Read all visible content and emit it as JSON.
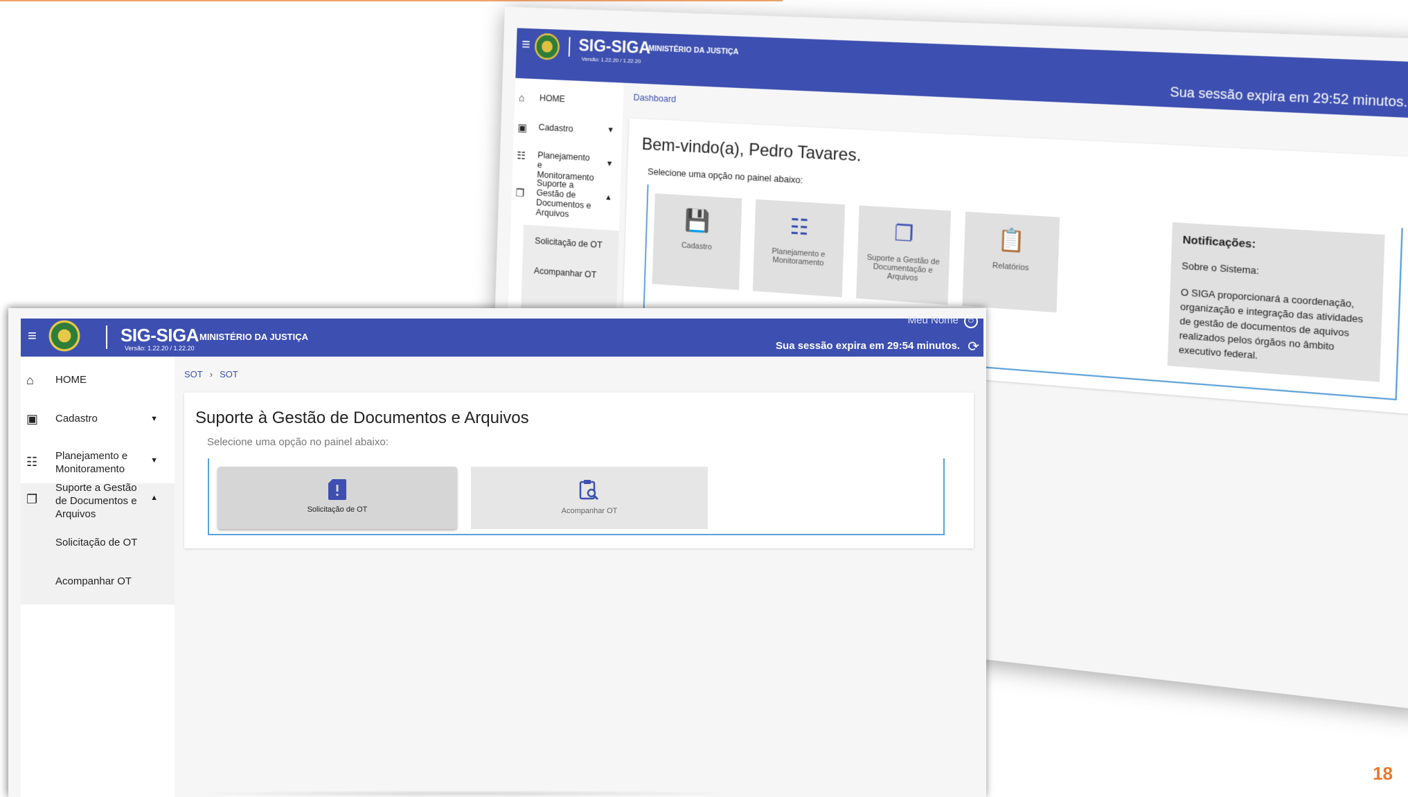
{
  "page_number": "18",
  "colors": {
    "header": "#3d4fb0",
    "accent_border": "#5aa0d8",
    "page_number": "#e8782a"
  },
  "back_window": {
    "header": {
      "menu_icon": "hamburger-icon",
      "app_name": "SIG-SIGA",
      "ministry": "MINISTÉRIO DA JUSTIÇA",
      "version": "Versão: 1.22.20 / 1.22.20",
      "session": "Sua sessão expira em 29:52 minutos.",
      "refresh_icon": "refresh-icon"
    },
    "sidebar": [
      {
        "icon": "home-icon",
        "label": "HOME"
      },
      {
        "icon": "badge-icon",
        "label": "Cadastro"
      },
      {
        "icon": "planning-icon",
        "label": "Planejamento e Monitoramento"
      },
      {
        "icon": "documents-icon",
        "label": "Suporte a Gestão de Documentos e Arquivos"
      }
    ],
    "sub_items": [
      "Solicitação de OT",
      "Acompanhar OT"
    ],
    "breadcrumb": "Dashboard",
    "welcome": "Bem-vindo(a), Pedro Tavares.",
    "choose": "Selecione uma opção no painel abaixo:",
    "tiles": [
      {
        "icon": "save-icon",
        "label": "Cadastro"
      },
      {
        "icon": "planning-icon",
        "label": "Planejamento e Monitoramento"
      },
      {
        "icon": "documents-icon",
        "label": "Suporte a Gestão de Documentação e Arquivos"
      },
      {
        "icon": "clipboard-icon",
        "label": "Relatórios"
      }
    ],
    "notifications": {
      "title": "Notificações:",
      "subtitle": "Sobre o Sistema:",
      "body": "O SIGA proporcionará a coordenação, organização e integração das atividades de gestão de documentos de aquivos realizados pelos órgãos no âmbito executivo federal."
    }
  },
  "front_window": {
    "header": {
      "menu_icon": "hamburger-icon",
      "app_name": "SIG-SIGA",
      "ministry": "MINISTÉRIO DA JUSTIÇA",
      "version": "Versão: 1.22.20 / 1.22.20",
      "user": "Meu Nome",
      "session": "Sua sessão expira em 29:54 minutos.",
      "refresh_icon": "refresh-icon"
    },
    "sidebar": {
      "home": "HOME",
      "cadastro": "Cadastro",
      "planejamento_1": "Planejamento e",
      "planejamento_2": "Monitoramento",
      "suporte_1": "Suporte a Gestão",
      "suporte_2": "de Documentos e",
      "suporte_3": "Arquivos",
      "sub_items": [
        "Solicitação de OT",
        "Acompanhar OT"
      ]
    },
    "breadcrumb": [
      "SOT",
      "SOT"
    ],
    "title": "Suporte à Gestão de Documentos e Arquivos",
    "choose": "Selecione uma opção no painel abaixo:",
    "tiles": [
      {
        "icon": "alert-doc-icon",
        "label": "Solicitação de OT",
        "selected": true
      },
      {
        "icon": "clipboard-search-icon",
        "label": "Acompanhar OT",
        "selected": false
      }
    ]
  }
}
